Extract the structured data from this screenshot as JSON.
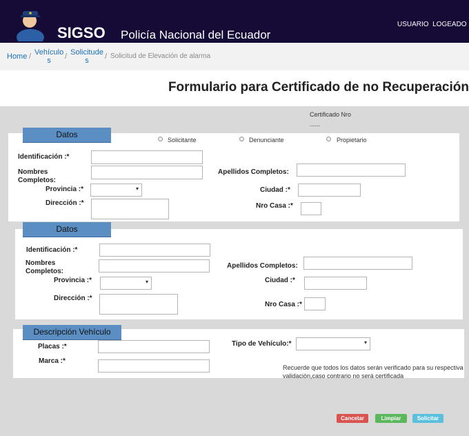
{
  "header": {
    "brand": "SIGSO",
    "subtitle": "Policía Nacional del Ecuador",
    "user": "USUARIO  LOGEADO"
  },
  "breadcrumb": {
    "home": "Home",
    "vehiculos_1": "Vehículo",
    "vehiculos_2": "s",
    "solicitudes_1": "Solicitude",
    "solicitudes_2": "s",
    "current": "Solicitud de Elevación de alarma",
    "separator": "/"
  },
  "page": {
    "title": "Formulario para Certificado de no Recuperación",
    "cert_label": "Certificado Nro",
    "cert_value": "......"
  },
  "section1": {
    "tab": "Datos",
    "radios": [
      "Solicitante",
      "Denunciante",
      "Propietario"
    ],
    "identificacion": "Identificación :*",
    "nombres_1": "Nombres",
    "nombres_2": "Completos:",
    "apellidos": "Apellidos Completos:",
    "provincia": "Provincia :*",
    "ciudad": "Ciudad :*",
    "direccion": "Dirección :*",
    "nro_casa": "Nro Casa :*"
  },
  "section2": {
    "tab": "Datos",
    "identificacion": "Identificación :*",
    "nombres_1": "Nombres",
    "nombres_2": "Completos:",
    "apellidos": "Apellidos Completos:",
    "provincia": "Provincia :*",
    "ciudad": "Ciudad :*",
    "direccion": "Dirección :*",
    "nro_casa": "Nro Casa :*"
  },
  "section3": {
    "tab": "Descripción Vehículo",
    "placas": "Placas :*",
    "marca": "Marca :*",
    "tipo": "Tipo de Vehículo:*",
    "note_1": "Recuerde que todos los datos serán verificado para su respectiva",
    "note_2": "validación,caso contrario no será certificada"
  },
  "buttons": {
    "cancel": "Cancelar",
    "clear": "Limpiar",
    "submit": "Solicitar"
  },
  "colors": {
    "header": "#160a36",
    "tab": "#5b8fc3",
    "cancel": "#d9534f",
    "clear": "#5cb85c",
    "submit": "#5bc0de"
  }
}
